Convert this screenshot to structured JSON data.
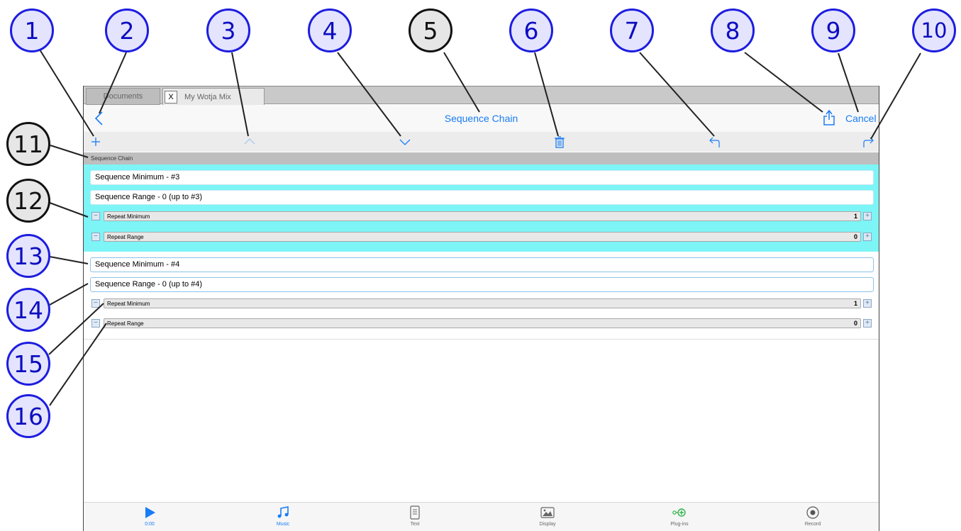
{
  "callouts": [
    "1",
    "2",
    "3",
    "4",
    "5",
    "6",
    "7",
    "8",
    "9",
    "10",
    "11",
    "12",
    "13",
    "14",
    "15",
    "16"
  ],
  "tabs": {
    "documents": "Documents",
    "close": "X",
    "active": "My Wotja Mix"
  },
  "nav": {
    "title": "Sequence Chain",
    "cancel": "Cancel"
  },
  "toolbar_icons": [
    "plus-icon",
    "chevron-up-icon",
    "chevron-down-icon",
    "trash-icon",
    "undo-icon",
    "redo-icon"
  ],
  "section_header": "Sequence Chain",
  "groups": [
    {
      "selected": true,
      "sequence_minimum": "Sequence Minimum - #3",
      "sequence_range": "Sequence Range - 0 (up to #3)",
      "repeat_minimum": {
        "label": "Repeat Minimum",
        "value": "1"
      },
      "repeat_range": {
        "label": "Repeat Range",
        "value": "0"
      }
    },
    {
      "selected": false,
      "sequence_minimum": "Sequence Minimum - #4",
      "sequence_range": "Sequence Range - 0 (up to #4)",
      "repeat_minimum": {
        "label": "Repeat Minimum",
        "value": "1"
      },
      "repeat_range": {
        "label": "Repeat Range",
        "value": "0"
      }
    }
  ],
  "bottom_tabs": [
    {
      "label": "0:00",
      "icon": "play-icon",
      "active": true
    },
    {
      "label": "Music",
      "icon": "music-note-icon",
      "active": true
    },
    {
      "label": "Text",
      "icon": "text-document-icon",
      "active": false
    },
    {
      "label": "Display",
      "icon": "image-icon",
      "active": false
    },
    {
      "label": "Plug-ins",
      "icon": "plugin-icon",
      "active": false
    },
    {
      "label": "Record",
      "icon": "record-icon",
      "active": false
    }
  ],
  "colors": {
    "accent": "#1a7cf5",
    "selected_group": "#7df4f6",
    "plugin_green": "#2fb34a",
    "callout_blue": "#1d1de0",
    "callout_fill": "#e4e4ff"
  }
}
